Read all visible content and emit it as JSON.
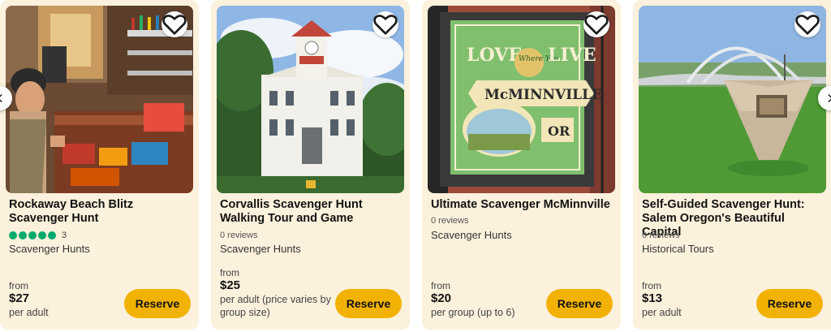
{
  "cards": [
    {
      "title": "Rockaway Beach Blitz Scavenger Hunt",
      "rating_count": "3",
      "reviews": "",
      "category": "Scavenger Hunts",
      "from_label": "from",
      "price": "$27",
      "unit": "per adult",
      "reserve_label": "Reserve"
    },
    {
      "title": "Corvallis Scavenger Hunt Walking Tour and Game",
      "rating_count": "",
      "reviews": "0 reviews",
      "category": "Scavenger Hunts",
      "from_label": "from",
      "price": "$25",
      "unit": "per adult (price varies by group size)",
      "reserve_label": "Reserve"
    },
    {
      "title": "Ultimate Scavenger McMinnville",
      "rating_count": "",
      "reviews": "0 reviews",
      "category": "Scavenger Hunts",
      "from_label": "from",
      "price": "$20",
      "unit": "per group (up to 6)",
      "reserve_label": "Reserve"
    },
    {
      "title": "Self-Guided Scavenger Hunt: Salem Oregon's Beautiful Capital",
      "rating_count": "",
      "reviews": "0 reviews",
      "category": "Historical Tours",
      "from_label": "from",
      "price": "$13",
      "unit": "per adult",
      "reserve_label": "Reserve"
    }
  ],
  "mural": {
    "line1": "LOVE",
    "line2": "Where You",
    "line3": "LIVE",
    "line4": "McMINNVILLE",
    "line5": "OR"
  },
  "icons": {
    "favorite": "heart-outline-icon",
    "prev": "chevron-left-icon",
    "next": "chevron-right-icon",
    "rating": "rating-bubble-icon"
  },
  "colors": {
    "card_bg": "#fcf1dc",
    "reserve_bg": "#f2b203",
    "rating_green": "#00aa6c"
  }
}
